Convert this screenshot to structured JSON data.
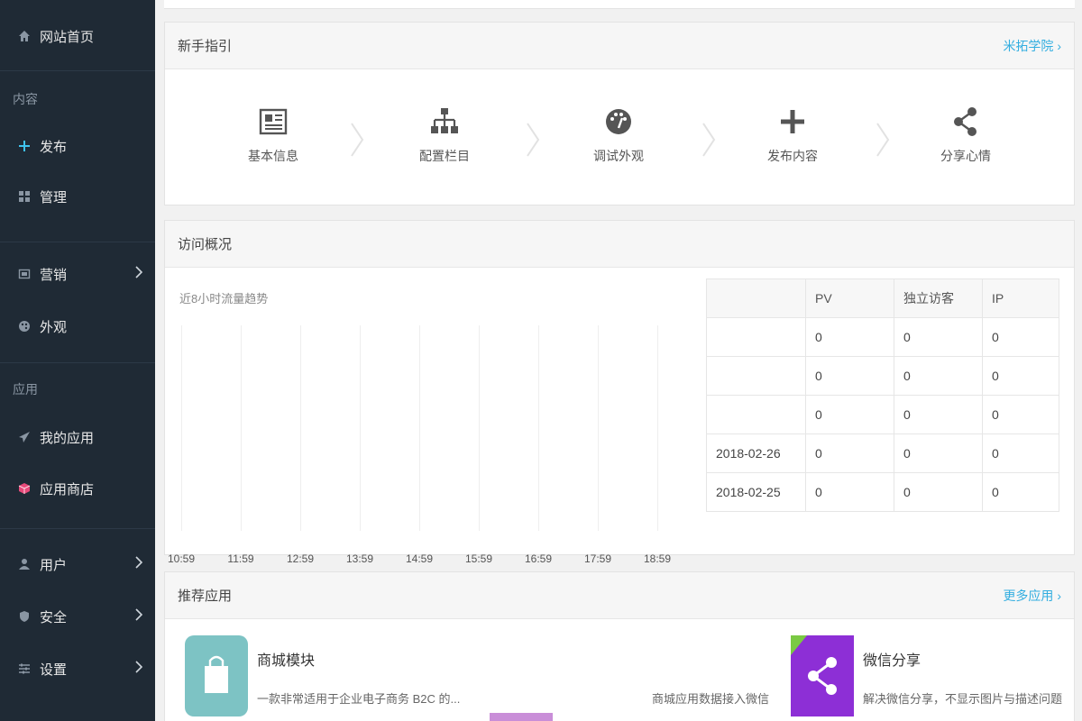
{
  "sidebar": {
    "home": "网站首页",
    "section_content": "内容",
    "publish": "发布",
    "manage": "管理",
    "marketing": "营销",
    "appearance": "外观",
    "section_apps": "应用",
    "my_apps": "我的应用",
    "app_store": "应用商店",
    "users": "用户",
    "security": "安全",
    "settings": "设置"
  },
  "guide": {
    "title": "新手指引",
    "link": "米拓学院 ›",
    "steps": [
      {
        "label": "基本信息",
        "icon": "newspaper-icon"
      },
      {
        "label": "配置栏目",
        "icon": "sitemap-icon"
      },
      {
        "label": "调试外观",
        "icon": "dashboard-icon"
      },
      {
        "label": "发布内容",
        "icon": "plus-icon"
      },
      {
        "label": "分享心情",
        "icon": "share-icon"
      }
    ]
  },
  "visits": {
    "title": "访问概况",
    "chart_title": "近8小时流量趋势",
    "x_ticks": [
      "10:59",
      "11:59",
      "12:59",
      "13:59",
      "14:59",
      "15:59",
      "16:59",
      "17:59",
      "18:59"
    ],
    "columns": [
      "",
      "PV",
      "独立访客",
      "IP"
    ],
    "rows": [
      [
        "",
        "0",
        "0",
        "0"
      ],
      [
        "",
        "0",
        "0",
        "0"
      ],
      [
        "",
        "0",
        "0",
        "0"
      ],
      [
        "2018-02-26",
        "0",
        "0",
        "0"
      ],
      [
        "2018-02-25",
        "0",
        "0",
        "0"
      ]
    ]
  },
  "recommend": {
    "title": "推荐应用",
    "link": "更多应用 ›",
    "apps": [
      {
        "name": "商城模块",
        "desc": "一款非常适用于企业电子商务 B2C 的..."
      },
      {
        "name": "",
        "desc": "商城应用数据接入微信"
      },
      {
        "name": "微信分享",
        "desc": "解决微信分享，不显示图片与描述问题"
      }
    ]
  },
  "colors": {
    "sidebar_bg": "#1f2a35",
    "accent": "#33aee0",
    "app_store_icon": "#e84a7a",
    "shop_app_bg": "#7dc3c4",
    "wechat_app_bg": "#8d2fd6"
  }
}
